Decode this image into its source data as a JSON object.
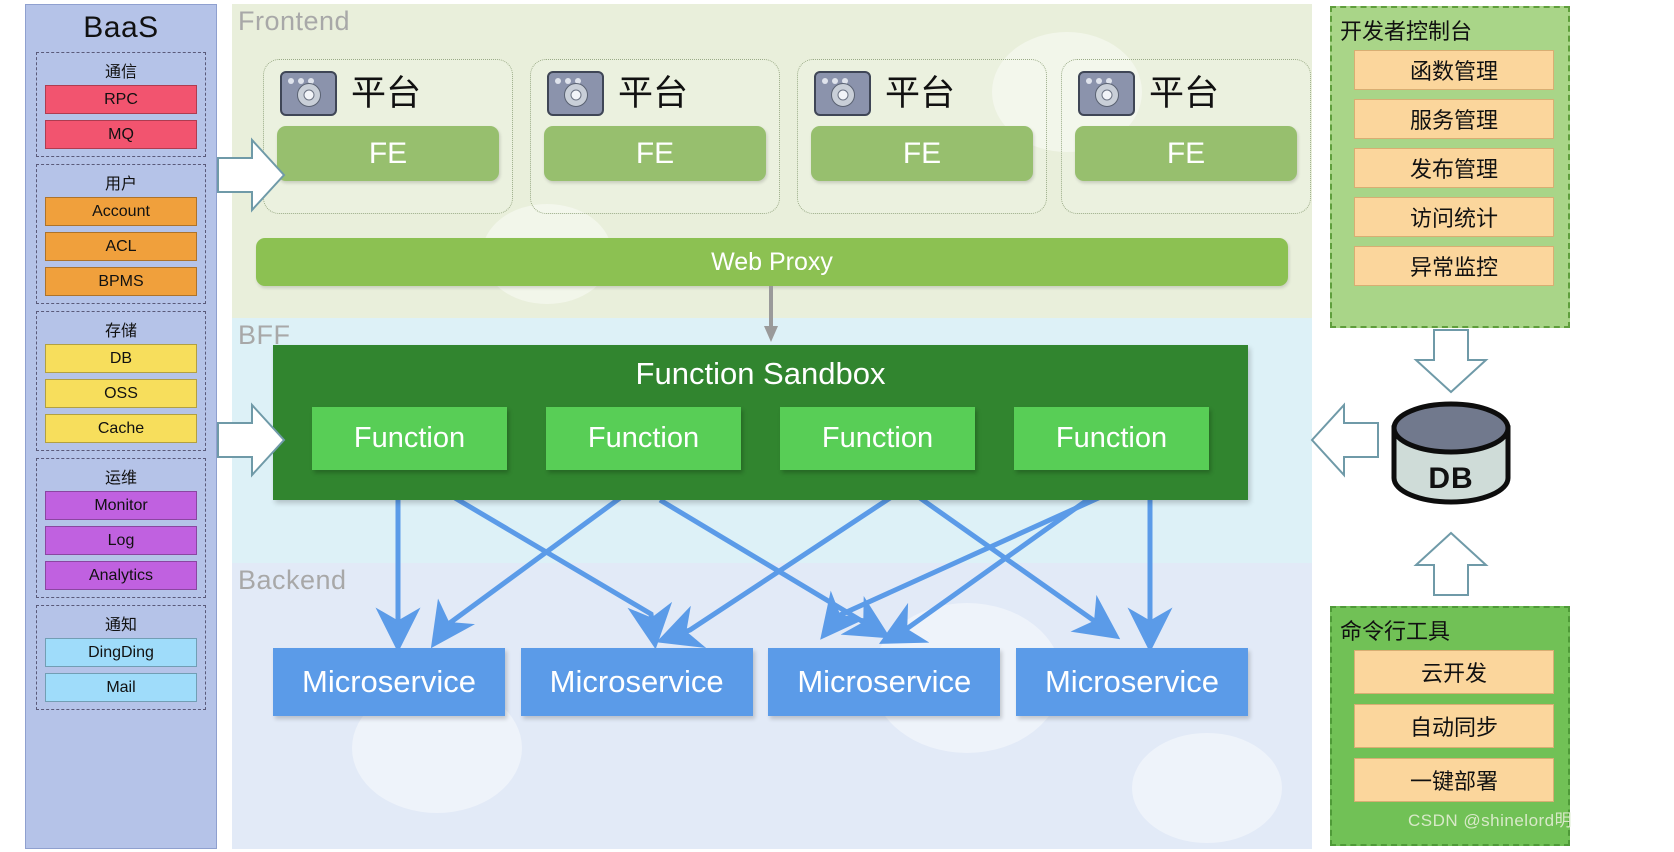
{
  "baas": {
    "title": "BaaS",
    "groups": [
      {
        "title": "通信",
        "color": "#f2546f",
        "items": [
          "RPC",
          "MQ"
        ]
      },
      {
        "title": "用户",
        "color": "#f0a03c",
        "items": [
          "Account",
          "ACL",
          "BPMS"
        ]
      },
      {
        "title": "存储",
        "color": "#f7de5c",
        "items": [
          "DB",
          "OSS",
          "Cache"
        ]
      },
      {
        "title": "运维",
        "color": "#c061e0",
        "items": [
          "Monitor",
          "Log",
          "Analytics"
        ]
      },
      {
        "title": "通知",
        "color": "#9fdcfa",
        "items": [
          "DingDing",
          "Mail"
        ]
      }
    ]
  },
  "layers": {
    "frontend_label": "Frontend",
    "bff_label": "BFF",
    "backend_label": "Backend"
  },
  "frontend": {
    "platforms": [
      {
        "icon": "browser-icon",
        "label": "平台",
        "fe": "FE"
      },
      {
        "icon": "browser-icon",
        "label": "平台",
        "fe": "FE"
      },
      {
        "icon": "browser-icon",
        "label": "平台",
        "fe": "FE"
      },
      {
        "icon": "browser-icon",
        "label": "平台",
        "fe": "FE"
      }
    ],
    "web_proxy": "Web Proxy"
  },
  "bff": {
    "sandbox_title": "Function Sandbox",
    "functions": [
      "Function",
      "Function",
      "Function",
      "Function"
    ]
  },
  "backend": {
    "microservices": [
      "Microservice",
      "Microservice",
      "Microservice",
      "Microservice"
    ]
  },
  "dev_console": {
    "title": "开发者控制台",
    "items": [
      "函数管理",
      "服务管理",
      "发布管理",
      "访问统计",
      "异常监控"
    ]
  },
  "cli_tool": {
    "title": "命令行工具",
    "items": [
      "云开发",
      "自动同步",
      "一键部署"
    ]
  },
  "database": {
    "label": "DB"
  },
  "watermark": "CSDN @shinelord明",
  "colors": {
    "baas_bg": "#b5c3e8",
    "frontend_bg": "#e9efdb",
    "bff_bg": "#ddf1f7",
    "backend_bg": "#e2eaf7",
    "sandbox": "#31852f",
    "function": "#58ce56",
    "microservice": "#5b9be8",
    "web_proxy": "#8cc152",
    "fe": "#97bf6e",
    "dev_console_bg": "#a9d588",
    "cli_bg": "#71c156",
    "panel_item": "#fbd69c",
    "wire": "#5b9be8"
  }
}
